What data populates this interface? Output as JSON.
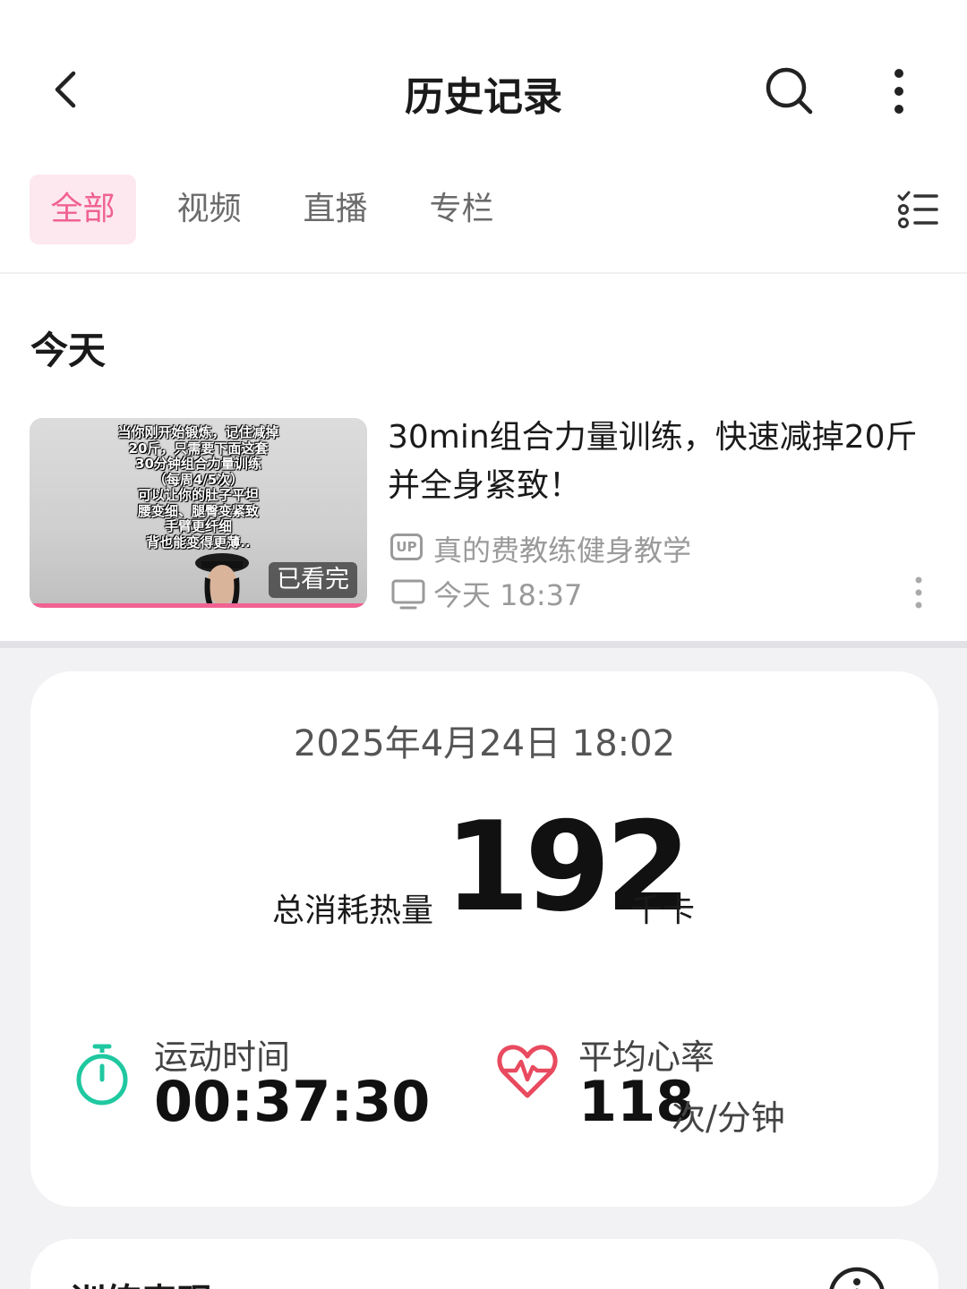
{
  "header": {
    "title": "历史记录",
    "icons": [
      "back-arrow-icon",
      "search-icon",
      "more-vertical-icon"
    ]
  },
  "tabs": [
    {
      "label": "全部",
      "active": true
    },
    {
      "label": "视频",
      "active": false
    },
    {
      "label": "直播",
      "active": false
    },
    {
      "label": "专栏",
      "active": false
    }
  ],
  "section": {
    "title": "今天"
  },
  "history_item": {
    "thumbnail_caption": "当你刚开始锻炼，记住减掉\n20斤，只需要下面这套\n30分钟组合力量训练\n（每周4/5次）\n可以让你的肚子平坦\n腰变细、腿臀变紧致\n手臂更纤细\n背也能变得更薄..",
    "badge": "已看完",
    "progress": 1.0,
    "title": "30min组合力量训练，快速减掉20斤并全身紧致！",
    "up_tag": "UP",
    "author": "真的费教练健身教学",
    "watched_at": "今天 18:37"
  },
  "workout_card": {
    "date": "2025年4月24日 18:02",
    "calories_label": "总消耗热量",
    "calories_value": "192",
    "calories_unit": "千卡",
    "duration_label": "运动时间",
    "duration_value": "00:37:30",
    "heart_rate_label": "平均心率",
    "heart_rate_value": "118",
    "heart_rate_unit": "次/分钟"
  },
  "next_card": {
    "title": "训练表现"
  },
  "colors": {
    "accent_pink": "#f06292",
    "timer_green": "#1fc8a0",
    "heart_red": "#e84a5f"
  }
}
